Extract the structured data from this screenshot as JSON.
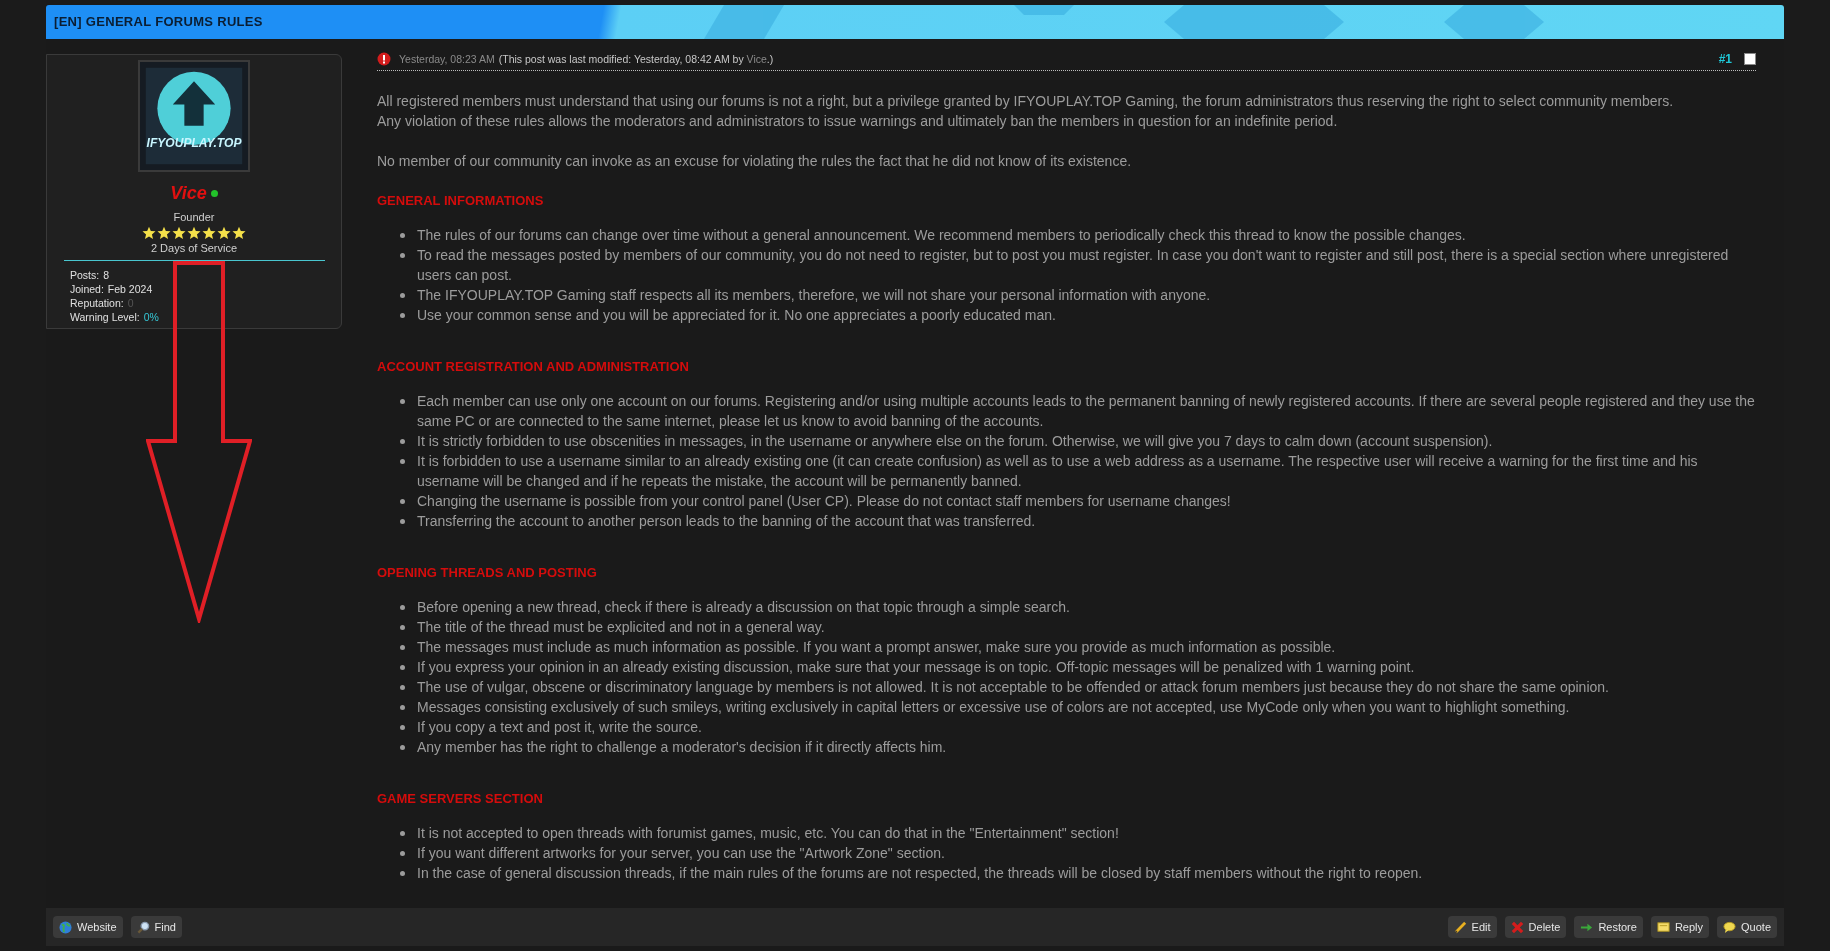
{
  "thread": {
    "title": "[EN] GENERAL FORUMS RULES"
  },
  "author": {
    "name": "Vice",
    "online": true,
    "logo_text": "IFYOUPLAY.TOP",
    "rank": "Founder",
    "stars": 7,
    "service": "2 Days of Service",
    "stats": [
      {
        "label": "Posts:",
        "value": "8",
        "kind": "plain"
      },
      {
        "label": "Joined:",
        "value": "Feb 2024",
        "kind": "plain"
      },
      {
        "label": "Reputation:",
        "value": "0",
        "kind": "muted"
      },
      {
        "label": "Warning Level:",
        "value": "0%",
        "kind": "accent"
      }
    ]
  },
  "post": {
    "date": "Yesterday, 08:23 AM",
    "edit_prefix": "(This post was last modified: Yesterday, 08:42 AM by",
    "edit_user": "Vice",
    "edit_suffix": ".)",
    "number": "#1",
    "checked": false,
    "intro": [
      "All registered members must understand that using our forums is not a right, but a privilege granted by IFYOUPLAY.TOP Gaming, the forum administrators thus reserving the right to select community members.\nAny violation of these rules allows the moderators and administrators to issue warnings and ultimately ban the members in question for an indefinite period.",
      "No member of our community can invoke as an excuse for violating the rules the fact that he did not know of its existence."
    ],
    "sections": [
      {
        "heading": "GENERAL INFORMATIONS",
        "items": [
          "The rules of our forums can change over time without a general announcement. We recommend members to periodically check this thread to know the possible changes.",
          "To read the messages posted by members of our community, you do not need to register, but to post you must register. In case you don't want to register and still post, there is a special section where unregistered users can post.",
          "The IFYOUPLAY.TOP Gaming staff respects all its members, therefore, we will not share your personal information with anyone.",
          "Use your common sense and you will be appreciated for it. No one appreciates a poorly educated man."
        ]
      },
      {
        "heading": "ACCOUNT REGISTRATION AND ADMINISTRATION",
        "items": [
          "Each member can use only one account on our forums. Registering and/or using multiple accounts leads to the permanent banning of newly registered accounts. If there are several people registered and they use the same PC or are connected to the same internet, please let us know to avoid banning of the accounts.",
          "It is strictly forbidden to use obscenities in messages, in the username or anywhere else on the forum. Otherwise, we will give you 7 days to calm down (account suspension).",
          "It is forbidden to use a username similar to an already existing one (it can create confusion) as well as to use a web address as a username. The respective user will receive a warning for the first time and his username will be changed and if he repeats the mistake, the account will be permanently banned.",
          "Changing the username is possible from your control panel (User CP). Please do not contact staff members for username changes!",
          "Transferring the account to another person leads to the banning of the account that was transferred."
        ]
      },
      {
        "heading": "OPENING THREADS AND POSTING",
        "items": [
          "Before opening a new thread, check if there is already a discussion on that topic through a simple search.",
          "The title of the thread must be explicited and not in a general way.",
          "The messages must include as much information as possible. If you want a prompt answer, make sure you provide as much information as possible.",
          "If you express your opinion in an already existing discussion, make sure that your message is on topic. Off-topic messages will be penalized with 1 warning point.",
          "The use of vulgar, obscene or discriminatory language by members is not allowed. It is not acceptable to be offended or attack forum members just because they do not share the same opinion.",
          "Messages consisting exclusively of such smileys, writing exclusively in capital letters or excessive use of colors are not accepted, use MyCode only when you want to highlight something.",
          "If you copy a text and post it, write the source.",
          "Any member has the right to challenge a moderator's decision if it directly affects him."
        ]
      },
      {
        "heading": "GAME SERVERS SECTION",
        "items": [
          "It is not accepted to open threads with forumist games, music, etc. You can do that in the \"Entertainment\" section!",
          "If you want different artworks for your server, you can use the \"Artwork Zone\" section.",
          "In the case of general discussion threads, if the main rules of the forums are not respected, the threads will be closed by staff members without the right to reopen."
        ]
      }
    ]
  },
  "left_buttons": [
    {
      "label": "Website",
      "kind": "globe"
    },
    {
      "label": "Find",
      "kind": "find"
    }
  ],
  "right_buttons": [
    {
      "label": "Edit",
      "kind": "edit"
    },
    {
      "label": "Delete",
      "kind": "delete"
    },
    {
      "label": "Restore",
      "kind": "restore"
    },
    {
      "label": "Reply",
      "kind": "reply"
    },
    {
      "label": "Quote",
      "kind": "quote"
    }
  ]
}
